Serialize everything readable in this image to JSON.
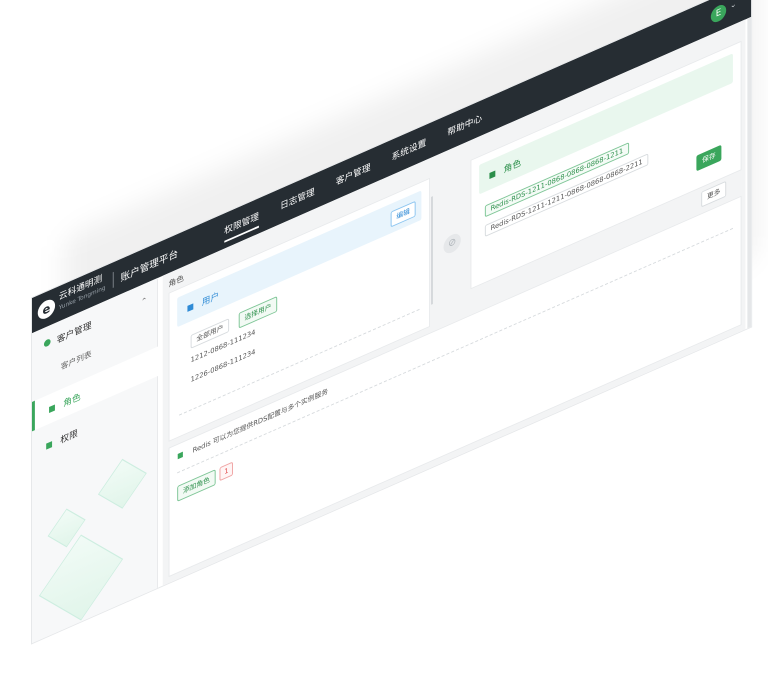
{
  "header": {
    "brand": "云科通明测",
    "brand_sub": "Yunke Tongming",
    "divider": "|",
    "platform": "账户管理平台",
    "nav": [
      "权限管理",
      "日志管理",
      "客户管理",
      "系统设置",
      "帮助中心"
    ],
    "avatar_initial": "E",
    "avatar_caret": "⌄"
  },
  "sidebar": {
    "group": "客户管理",
    "group_chevron": "⌃",
    "sub_item": "客户列表",
    "items": [
      {
        "label": "角色",
        "active": true
      },
      {
        "label": "权限",
        "active": false
      }
    ]
  },
  "main": {
    "breadcrumb": "角色",
    "user_panel": {
      "title": "用户",
      "action": "编辑",
      "filter_label": "全部用户",
      "tag_label": "选择用户",
      "rows": [
        "1212-0868-111234",
        "1226-0868-111234"
      ]
    },
    "connector_icon": "link-icon",
    "role_panel": {
      "title": "角色",
      "rows": [
        "Redis-RDS-1211-0868-0868-0868-1211",
        "Redis-RDS-1211-1211-0868-0868-0868-2211"
      ],
      "confirm": "保存",
      "more": "更多"
    },
    "note": "Redis 可以为您提供RDS配置与多个实例服务",
    "bottom_tag": "添加角色",
    "bottom_badge": "1"
  },
  "colors": {
    "topbar": "#262d33",
    "accent_green": "#3aa65c",
    "accent_blue": "#2f8bd6",
    "user_panel_bg": "#e8f4fc",
    "role_panel_bg": "#e9f7ee"
  }
}
